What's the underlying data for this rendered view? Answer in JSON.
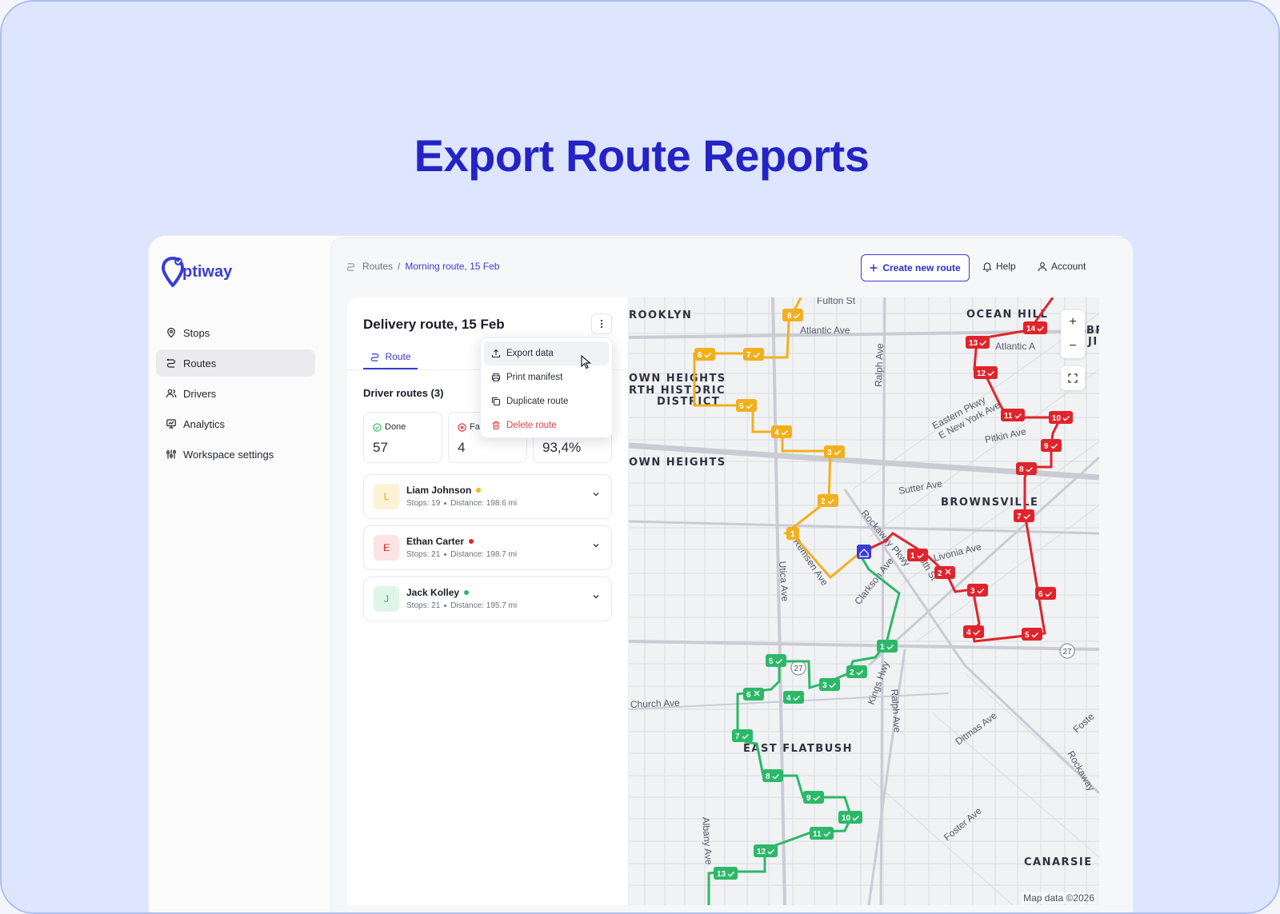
{
  "hero": {
    "title": "Export Route Reports"
  },
  "logo": {
    "text": "ptiway"
  },
  "sidebar": {
    "items": [
      {
        "label": "Stops",
        "icon": "map-pin-icon"
      },
      {
        "label": "Routes",
        "icon": "route-icon",
        "active": true
      },
      {
        "label": "Drivers",
        "icon": "users-icon"
      },
      {
        "label": "Analytics",
        "icon": "chart-icon"
      },
      {
        "label": "Workspace settings",
        "icon": "sliders-icon"
      }
    ]
  },
  "topbar": {
    "breadcrumb_root": "Routes",
    "breadcrumb_sep": "/",
    "breadcrumb_current": "Morning route, 15 Feb",
    "create_button": "Create new route",
    "help": "Help",
    "account": "Account"
  },
  "panel": {
    "title": "Delivery route, 15 Feb",
    "tab_route": "Route",
    "section_title": "Driver routes (3)",
    "stats": [
      {
        "label": "Done",
        "value": "57"
      },
      {
        "label": "Fa",
        "value": "4"
      },
      {
        "label": "",
        "value": "93,4%"
      }
    ],
    "drivers": [
      {
        "initial": "L",
        "name": "Liam Johnson",
        "stops": "Stops: 19",
        "distance": "Distance: 198.6 mi",
        "color": "#f5b81c"
      },
      {
        "initial": "E",
        "name": "Ethan Carter",
        "stops": "Stops: 21",
        "distance": "Distance: 198.7 mi",
        "color": "#e0242b"
      },
      {
        "initial": "J",
        "name": "Jack Kolley",
        "stops": "Stops: 21",
        "distance": "Distance: 195.7 mi",
        "color": "#2cb868"
      }
    ]
  },
  "dropdown": {
    "items": [
      {
        "label": "Export data",
        "icon": "upload-icon"
      },
      {
        "label": "Print manifest",
        "icon": "printer-icon"
      },
      {
        "label": "Duplicate route",
        "icon": "copy-icon"
      },
      {
        "label": "Delete route",
        "icon": "trash-icon"
      }
    ]
  },
  "map": {
    "neighborhoods": [
      "ROOKLYN",
      "OCEAN HILL",
      "OWN HEIGHTS",
      "RTH HISTORIC",
      "DISTRICT",
      "OWN HEIGHTS",
      "BROWNSVILLE",
      "EAST FLATBUSH",
      "CANARSIE",
      "BR",
      "JI"
    ],
    "streets": [
      "Fulton St",
      "Atlantic Ave",
      "Ralph Ave",
      "Eastern Pkwy",
      "E New York Ave",
      "Pitkin Ave",
      "Sutter Ave",
      "Livonia Ave",
      "Rockaway Pkwy",
      "Clarkson Ave",
      "Utica Ave",
      "Remsen Ave",
      "Church Ave",
      "Kings Hwy",
      "Ditmas Ave",
      "Foster Ave",
      "Albany Ave",
      "Ralph Ave",
      "Rockaway",
      "Foste",
      "98th St",
      "Atlantic A"
    ],
    "route_shield": "27",
    "zoom_in": "+",
    "zoom_out": "−",
    "attribution": "Map data ©2026",
    "colors": {
      "yellow": "#f2b01e",
      "red": "#e0242b",
      "green": "#2cb868",
      "depot": "#3b3bd6"
    }
  }
}
